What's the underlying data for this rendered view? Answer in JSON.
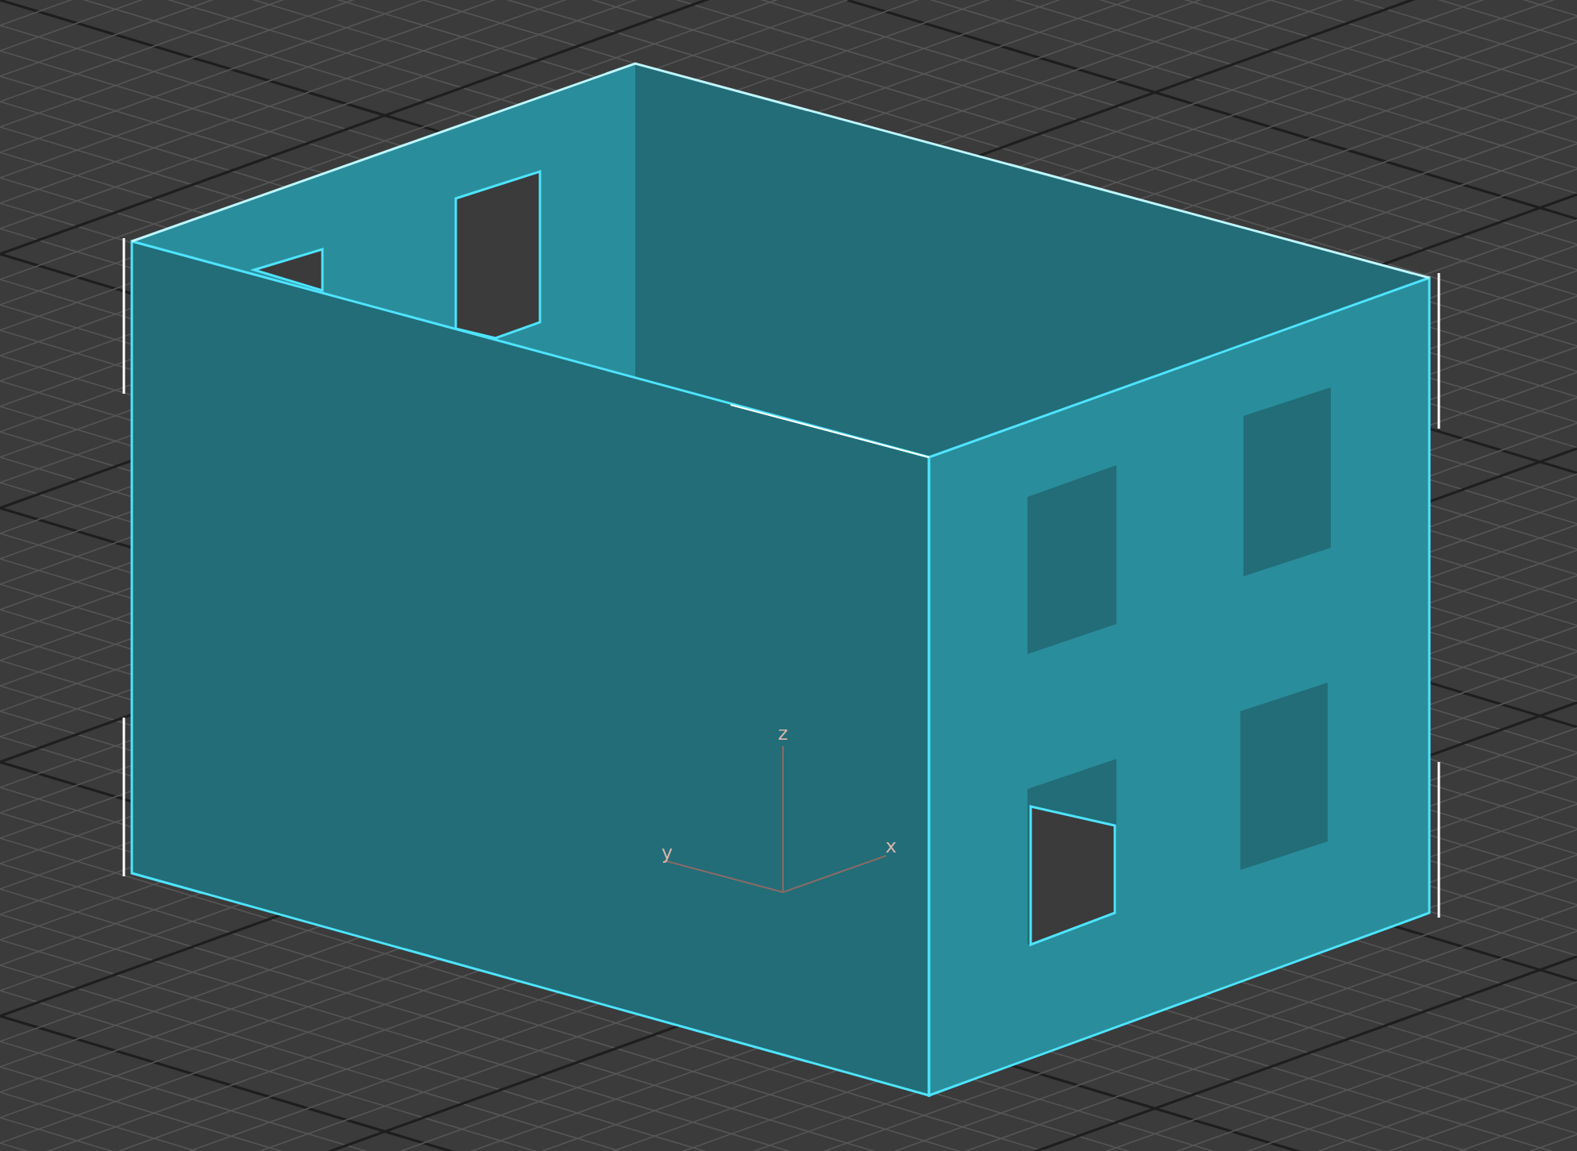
{
  "viewport": {
    "axis_labels": [
      {
        "text": "z"
      },
      {
        "text": "y"
      },
      {
        "text": "x"
      }
    ]
  }
}
